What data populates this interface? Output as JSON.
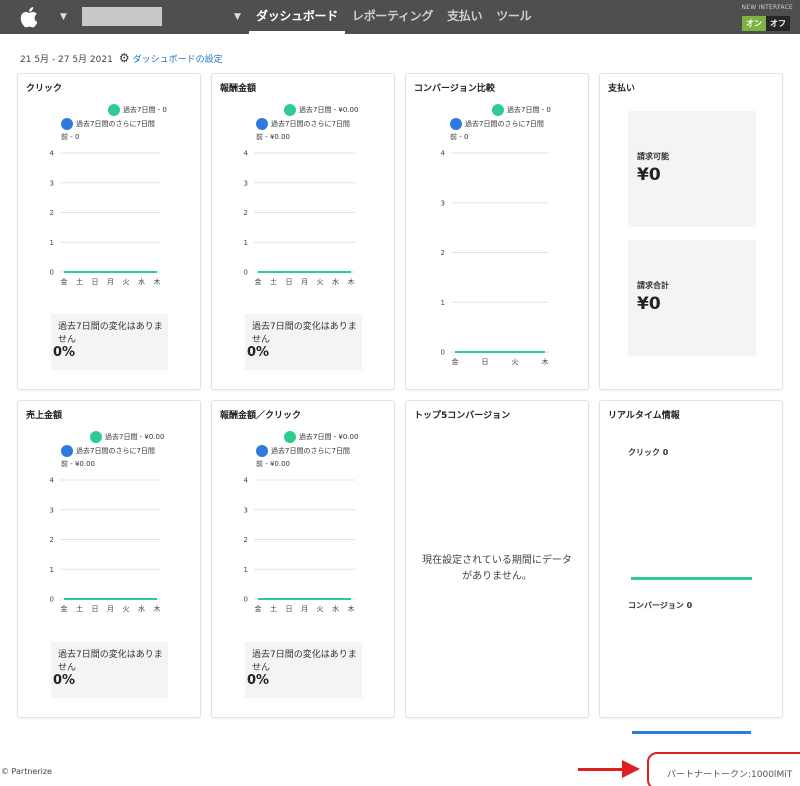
{
  "nav": {
    "tabs": [
      "ダッシュボード",
      "レポーティング",
      "支払い",
      "ツール"
    ],
    "active_index": 0,
    "new_interface_label": "NEW INTERFACE",
    "toggle_on": "オン",
    "toggle_off": "オフ",
    "logo_icon": "apple-logo-icon",
    "account_caret_icon": "caret-down-icon"
  },
  "header": {
    "date_range": "21 5月 - 27 5月 2021",
    "settings_link": "ダッシュボードの設定"
  },
  "colors": {
    "current_series": "#2ecc8f",
    "previous_series": "#2d7be0",
    "toggle_on": "#7cb342"
  },
  "cards": {
    "clicks": {
      "title": "クリック",
      "legend_current": "過去7日間 - 0",
      "legend_previous_1": "過去7日間のさらに7日間",
      "legend_previous_2": "前 - 0",
      "change_text": "過去7日間の変化はありません",
      "change_pct": "0%"
    },
    "commission": {
      "title": "報酬金額",
      "legend_current": "過去7日間 - ¥0.00",
      "legend_previous_1": "過去7日間のさらに7日間",
      "legend_previous_2": "前 - ¥0.00",
      "change_text": "過去7日間の変化はありません",
      "change_pct": "0%"
    },
    "conversion_rate": {
      "title": "コンバージョン比較",
      "legend_current": "過去7日間 - 0",
      "legend_previous_1": "過去7日間のさらに7日間",
      "legend_previous_2": "前 - 0"
    },
    "payments": {
      "title": "支払い",
      "billable_label": "請求可能",
      "billable_value": "¥0",
      "total_label": "請求合計",
      "total_value": "¥0"
    },
    "sales": {
      "title": "売上金額",
      "legend_current": "過去7日間 - ¥0.00",
      "legend_previous_1": "過去7日間のさらに7日間",
      "legend_previous_2": "前 - ¥0.00",
      "change_text": "過去7日間の変化はありません",
      "change_pct": "0%"
    },
    "commission_per_click": {
      "title": "報酬金額／クリック",
      "legend_current": "過去7日間 - ¥0.00",
      "legend_previous_1": "過去7日間のさらに7日間",
      "legend_previous_2": "前 - ¥0.00",
      "change_text": "過去7日間の変化はありません",
      "change_pct": "0%"
    },
    "top5": {
      "title": "トップ5コンバージョン",
      "no_data": "現在設定されている期間にデータがありません。"
    },
    "realtime": {
      "title": "リアルタイム情報",
      "clicks_label": "クリック 0",
      "conversions_label": "コンバージョン 0"
    }
  },
  "chart_data": [
    {
      "type": "line",
      "card": "clicks",
      "categories": [
        "金",
        "土",
        "日",
        "月",
        "火",
        "水",
        "木"
      ],
      "yticks": [
        0,
        1,
        2,
        3,
        4
      ],
      "ylim": [
        0,
        4
      ],
      "series": [
        {
          "name": "過去7日間",
          "values": [
            0,
            0,
            0,
            0,
            0,
            0,
            0
          ]
        },
        {
          "name": "過去7日間のさらに7日間前",
          "values": [
            0,
            0,
            0,
            0,
            0,
            0,
            0
          ]
        }
      ]
    },
    {
      "type": "line",
      "card": "commission",
      "categories": [
        "金",
        "土",
        "日",
        "月",
        "火",
        "水",
        "木"
      ],
      "yticks": [
        0,
        1,
        2,
        3,
        4
      ],
      "ylim": [
        0,
        4
      ],
      "series": [
        {
          "name": "過去7日間",
          "values": [
            0,
            0,
            0,
            0,
            0,
            0,
            0
          ]
        },
        {
          "name": "過去7日間のさらに7日間前",
          "values": [
            0,
            0,
            0,
            0,
            0,
            0,
            0
          ]
        }
      ]
    },
    {
      "type": "line",
      "card": "conversion_rate",
      "categories": [
        "金",
        "日",
        "火",
        "木"
      ],
      "yticks": [
        0,
        1,
        2,
        3,
        4
      ],
      "ylim": [
        0,
        4
      ],
      "series": [
        {
          "name": "過去7日間",
          "values": [
            0,
            0,
            0,
            0
          ]
        },
        {
          "name": "過去7日間のさらに7日間前",
          "values": [
            0,
            0,
            0,
            0
          ]
        }
      ]
    },
    {
      "type": "line",
      "card": "sales",
      "categories": [
        "金",
        "土",
        "日",
        "月",
        "火",
        "水",
        "木"
      ],
      "yticks": [
        0,
        1,
        2,
        3,
        4
      ],
      "ylim": [
        0,
        4
      ],
      "series": [
        {
          "name": "過去7日間",
          "values": [
            0,
            0,
            0,
            0,
            0,
            0,
            0
          ]
        },
        {
          "name": "過去7日間のさらに7日間前",
          "values": [
            0,
            0,
            0,
            0,
            0,
            0,
            0
          ]
        }
      ]
    },
    {
      "type": "line",
      "card": "commission_per_click",
      "categories": [
        "金",
        "土",
        "日",
        "月",
        "火",
        "水",
        "木"
      ],
      "yticks": [
        0,
        1,
        2,
        3,
        4
      ],
      "ylim": [
        0,
        4
      ],
      "series": [
        {
          "name": "過去7日間",
          "values": [
            0,
            0,
            0,
            0,
            0,
            0,
            0
          ]
        },
        {
          "name": "過去7日間のさらに7日間前",
          "values": [
            0,
            0,
            0,
            0,
            0,
            0,
            0
          ]
        }
      ]
    }
  ],
  "footer": {
    "copyright": "© Partnerize",
    "partner_token": "パートナートークン:1000lMiT"
  }
}
